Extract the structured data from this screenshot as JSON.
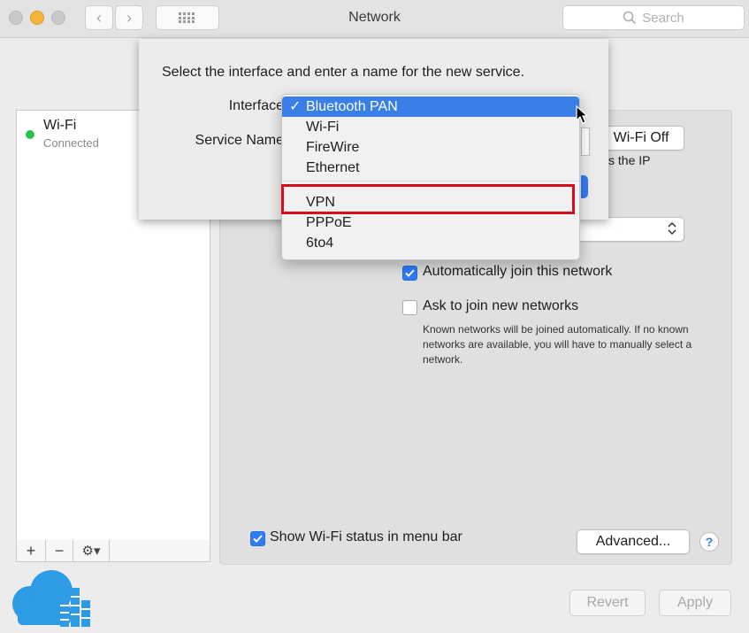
{
  "window": {
    "title": "Network"
  },
  "toolbar": {
    "back_glyph": "‹",
    "forward_glyph": "›",
    "search_placeholder": "Search"
  },
  "sidebar": {
    "items": [
      {
        "name": "Wi-Fi",
        "status": "Connected",
        "status_color": "#2ac24b"
      }
    ],
    "add_glyph": "+",
    "remove_glyph": "−",
    "gear_glyph": "⚙▾"
  },
  "main": {
    "wifi_off_button": "Wi-Fi Off",
    "ip_text_partial": "s the IP",
    "auto_join": {
      "label": "Automatically join this network",
      "checked": true
    },
    "ask_join": {
      "label": "Ask to join new networks",
      "checked": false
    },
    "ask_join_note": "Known networks will be joined automatically. If no known networks are available, you will have to manually select a network.",
    "show_status": {
      "label": "Show Wi-Fi status in menu bar",
      "checked": true
    },
    "advanced_button": "Advanced...",
    "help_glyph": "?",
    "revert_button": "Revert",
    "apply_button": "Apply"
  },
  "sheet": {
    "prompt": "Select the interface and enter a name for the new service.",
    "interface_label": "Interface",
    "service_name_label": "Service Name"
  },
  "dropdown": {
    "checkmark": "✓",
    "selected": "Bluetooth PAN",
    "options_group1": [
      "Bluetooth PAN",
      "Wi-Fi",
      "FireWire",
      "Ethernet"
    ],
    "options_group2": [
      "VPN",
      "PPPoE",
      "6to4"
    ],
    "highlighted_option": "VPN"
  },
  "colors": {
    "accent": "#2f7cf6",
    "highlight_box": "#d40d1b",
    "logo": "#2d9be6"
  }
}
